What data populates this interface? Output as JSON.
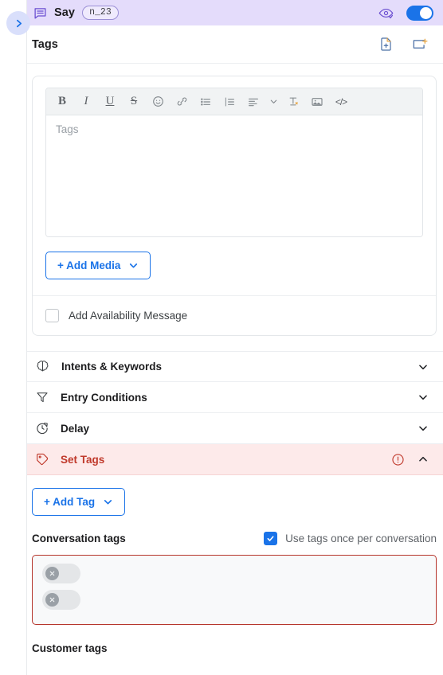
{
  "header": {
    "node_type": "Say",
    "node_id": "n_23",
    "preview_icon": "eye-preview-icon",
    "enabled_toggle": true,
    "message_icon": "message-square-icon"
  },
  "collapse_handle": {
    "icon": "chevron-right-icon"
  },
  "section": {
    "title": "Tags",
    "icons": [
      {
        "name": "add-document-icon"
      },
      {
        "name": "add-node-icon"
      }
    ]
  },
  "editor": {
    "toolbar": [
      {
        "name": "bold-icon",
        "glyph": "B"
      },
      {
        "name": "italic-icon",
        "glyph": "I"
      },
      {
        "name": "underline-icon",
        "glyph": "U"
      },
      {
        "name": "strikethrough-icon",
        "glyph": "S"
      },
      {
        "name": "emoji-icon"
      },
      {
        "name": "link-icon"
      },
      {
        "name": "bulleted-list-icon"
      },
      {
        "name": "numbered-list-icon"
      },
      {
        "name": "align-icon"
      },
      {
        "name": "align-chevron-down-icon"
      },
      {
        "name": "clear-formatting-icon"
      },
      {
        "name": "image-icon"
      },
      {
        "name": "code-icon",
        "glyph": "</>"
      }
    ],
    "content": "Tags",
    "add_media_label": "+ Add Media",
    "add_media_chevron": "chevron-down-icon",
    "availability_checkbox": {
      "label": "Add Availability Message",
      "checked": false
    }
  },
  "accordions": [
    {
      "label": "Intents & Keywords",
      "icon": "brain-icon",
      "state": "collapsed",
      "chevron": "chevron-down-icon",
      "error": false
    },
    {
      "label": "Entry Conditions",
      "icon": "funnel-icon",
      "state": "collapsed",
      "chevron": "chevron-down-icon",
      "error": false
    },
    {
      "label": "Delay",
      "icon": "clock-refresh-icon",
      "state": "collapsed",
      "chevron": "chevron-down-icon",
      "error": false
    },
    {
      "label": "Set Tags",
      "icon": "tag-icon",
      "state": "expanded",
      "chevron": "chevron-up-icon",
      "error": true,
      "error_icon": "alert-circle-icon"
    }
  ],
  "set_tags": {
    "add_tag_label": "+ Add Tag",
    "add_tag_chevron": "chevron-down-icon",
    "conversation_tags_label": "Conversation tags",
    "use_once_checkbox": {
      "label": "Use tags once per conversation",
      "checked": true
    },
    "chips": [
      {
        "label": "",
        "remove_icon": "close-circle-icon"
      },
      {
        "label": "",
        "remove_icon": "close-circle-icon"
      }
    ],
    "customer_tags_label": "Customer tags",
    "error_border_color": "#b5342b"
  },
  "colors": {
    "accent_blue": "#1a73e8",
    "header_purple": "#e4dcfb",
    "error_red": "#c0392b",
    "error_bg": "#fdeaea"
  }
}
